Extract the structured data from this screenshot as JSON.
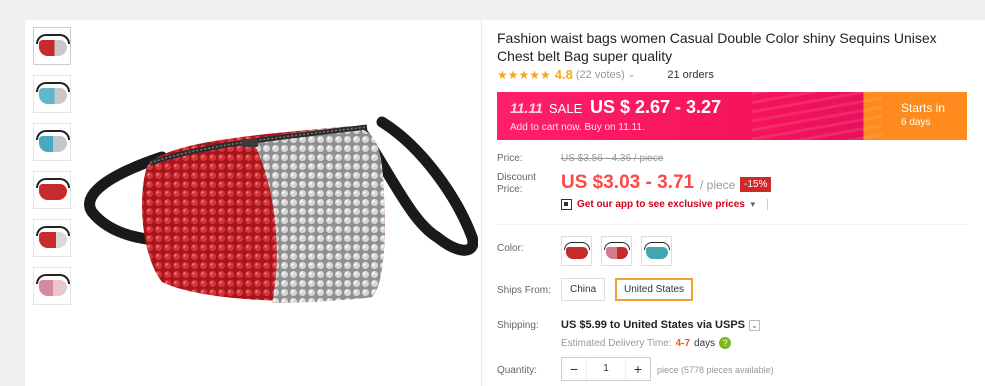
{
  "product": {
    "title": "Fashion waist bags women Casual Double Color shiny Sequins Unisex Chest belt Bag super quality",
    "stars": "★★★★★",
    "rating": "4.8",
    "votes": "(22 votes)",
    "orders": "21 orders"
  },
  "promo": {
    "tag": "11.11",
    "sale": "SALE",
    "price": "US $ 2.67 - 3.27",
    "subtext": "Add to cart now. Buy on 11.11.",
    "starts_in": "Starts in",
    "days": "6 days"
  },
  "pricing": {
    "price_label": "Price:",
    "old_price": "US $3.56 - 4.36 / piece",
    "discount_label": "Discount Price:",
    "discount_price": "US $3.03 - 3.71",
    "per": "/ piece",
    "discount_badge": "-15%",
    "app_promo": "Get our app to see exclusive prices"
  },
  "options": {
    "color_label": "Color:",
    "swatches": [
      "#c72a2a",
      "#d47a8c",
      "#3fa7b0"
    ],
    "ships_from_label": "Ships From:",
    "ships_from": [
      "China",
      "United States"
    ],
    "ships_from_selected": "United States"
  },
  "shipping": {
    "label": "Shipping:",
    "main": "US $5.99 to United States via USPS",
    "estimate_label": "Estimated Delivery Time:",
    "estimate_range": "4-7",
    "estimate_unit": "days"
  },
  "quantity": {
    "label": "Quantity:",
    "value": "1",
    "minus": "−",
    "plus": "+",
    "available": "piece (5778 pieces available)"
  },
  "thumbnails": [
    "#c72a2a",
    "#5fb7c9",
    "#4aa9c2",
    "#c72a2a",
    "#c72a2a",
    "#d68a9a"
  ],
  "colors": {
    "accent_red": "#ff4747",
    "promo_pink": "#f5145a",
    "promo_orange": "#ff8a1d",
    "star": "#f5a623"
  }
}
